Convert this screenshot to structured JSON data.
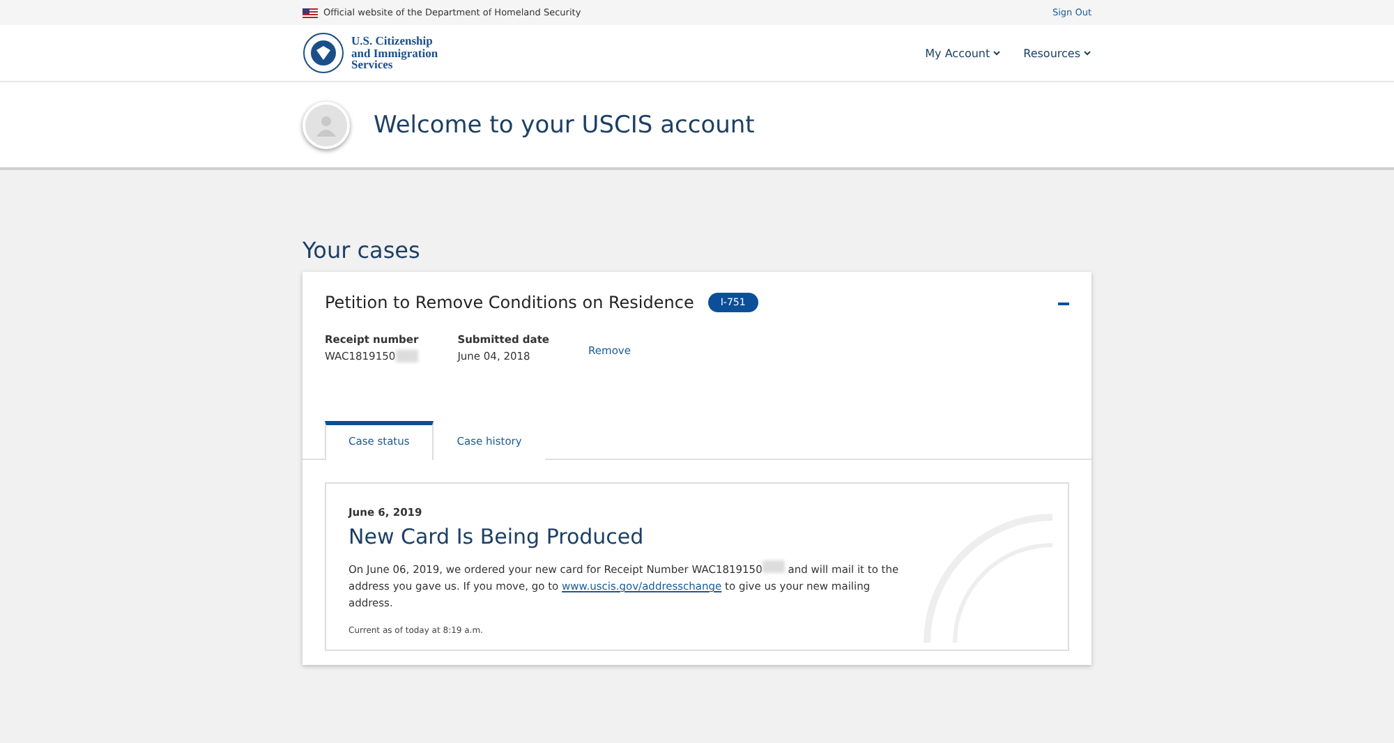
{
  "banner": {
    "text": "Official website of the Department of Homeland Security",
    "sign_out": "Sign Out"
  },
  "header": {
    "logo_lines": [
      "U.S. Citizenship",
      "and Immigration",
      "Services"
    ],
    "nav": [
      "My Account",
      "Resources"
    ]
  },
  "welcome": {
    "title": "Welcome to your USCIS account"
  },
  "cases_heading": "Your cases",
  "case": {
    "title": "Petition to Remove Conditions on Residence",
    "form_badge": "I-751",
    "expanded": true,
    "fields": [
      {
        "label": "Receipt number",
        "value": "WAC1819150",
        "redacted": true
      },
      {
        "label": "Submitted date",
        "value": "June 04, 2018",
        "redacted": false
      }
    ],
    "remove": "Remove",
    "tabs": [
      {
        "label": "Case status",
        "selected": true
      },
      {
        "label": "Case history",
        "selected": false
      }
    ],
    "status": {
      "date": "June 6, 2019",
      "title": "New Card Is Being Produced",
      "message_before": "On June 06, 2019, we ordered your new card for Receipt Number WAC1819150",
      "message_middle": "and will mail it to the address you gave us. If you move, go to",
      "link": "www.uscis.gov/addresschange",
      "message_after": "to give us your new mailing address.",
      "updated": "Current as of today at 8:19 a.m."
    }
  }
}
